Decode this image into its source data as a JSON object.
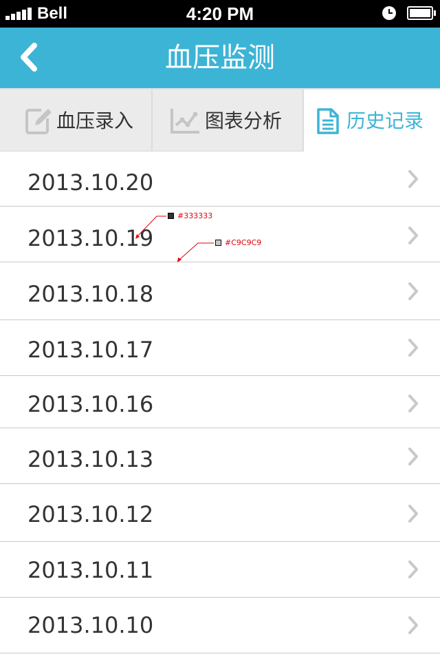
{
  "status_bar": {
    "carrier": "Bell",
    "time": "4:20 PM",
    "icons": [
      "signal-icon",
      "alarm-icon",
      "battery-icon"
    ]
  },
  "nav": {
    "title": "血压监测",
    "back_icon": "back-chevron-icon"
  },
  "tabs": [
    {
      "label": "血压录入",
      "icon": "edit-icon",
      "active": false
    },
    {
      "label": "图表分析",
      "icon": "line-chart-icon",
      "active": false
    },
    {
      "label": "历史记录",
      "icon": "document-icon",
      "active": true
    }
  ],
  "history": [
    {
      "date": "2013.10.20"
    },
    {
      "date": "2013.10.19"
    },
    {
      "date": "2013.10.18"
    },
    {
      "date": "2013.10.17"
    },
    {
      "date": "2013.10.16"
    },
    {
      "date": "2013.10.13"
    },
    {
      "date": "2013.10.12"
    },
    {
      "date": "2013.10.11"
    },
    {
      "date": "2013.10.10"
    }
  ],
  "annotations": {
    "text_color": "#333333",
    "divider_color": "#C9C9C9"
  },
  "colors": {
    "accent": "#3cb4d6",
    "text": "#333333",
    "divider": "#c9c9c9",
    "chevron": "#c9c9c9",
    "tab_bg": "#ebebeb"
  }
}
